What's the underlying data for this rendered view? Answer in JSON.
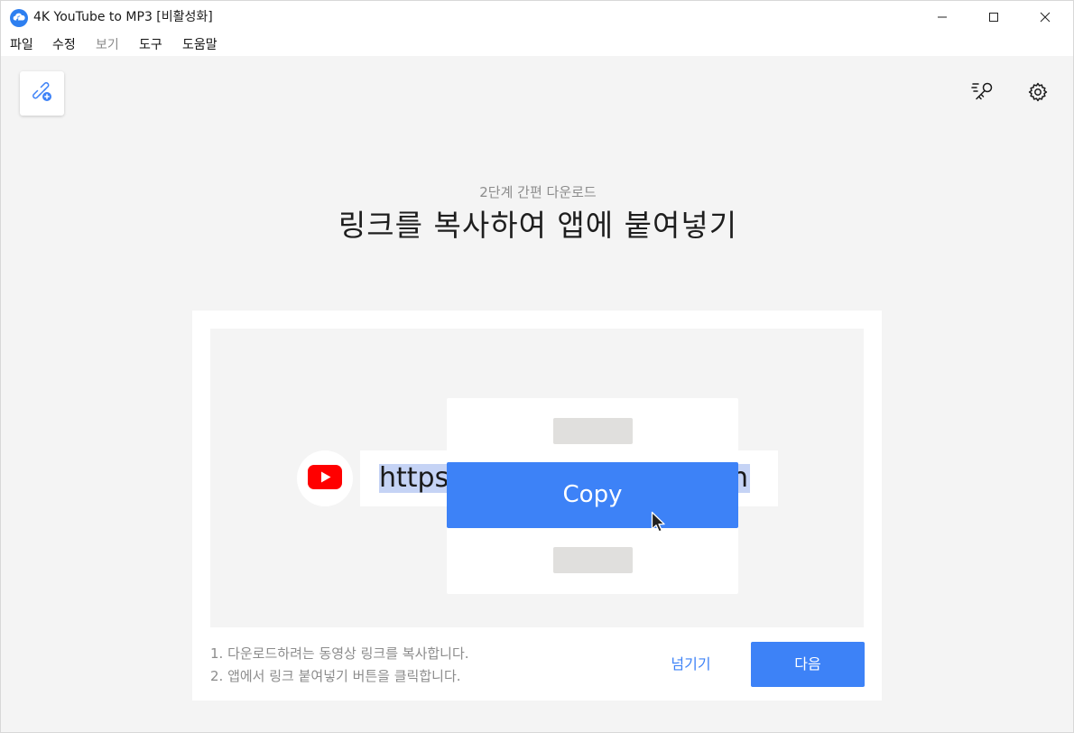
{
  "window": {
    "title": "4K YouTube to MP3 [비활성화]",
    "app_icon": "cloud-music-icon",
    "controls": [
      "minimize-icon",
      "maximize-icon",
      "close-icon"
    ]
  },
  "menubar": {
    "items": [
      {
        "label": "파일",
        "enabled": true
      },
      {
        "label": "수정",
        "enabled": true
      },
      {
        "label": "보기",
        "enabled": false
      },
      {
        "label": "도구",
        "enabled": true
      },
      {
        "label": "도움말",
        "enabled": true
      }
    ]
  },
  "toolbar": {
    "paste_link_icon": "link-add-icon",
    "smart_mode_icon": "key-sparkle-icon",
    "settings_icon": "gear-icon"
  },
  "onboarding": {
    "subtitle": "2단계 간편 다운로드",
    "title": "링크를 복사하여 앱에 붙여넣기",
    "illustration": {
      "url_start": "https",
      "url_end": "n",
      "copy_label": "Copy",
      "platform_icon": "youtube-icon"
    },
    "instructions": [
      "1. 다운로드하려는 동영상 링크를 복사합니다.",
      "2. 앱에서 링크 붙여넣기 버튼을 클릭합니다."
    ],
    "skip_label": "넘기기",
    "next_label": "다음"
  },
  "colors": {
    "accent": "#3d82f7",
    "background": "#f4f4f4",
    "selection": "#c5d3f5",
    "youtube_red": "#ff0000"
  }
}
